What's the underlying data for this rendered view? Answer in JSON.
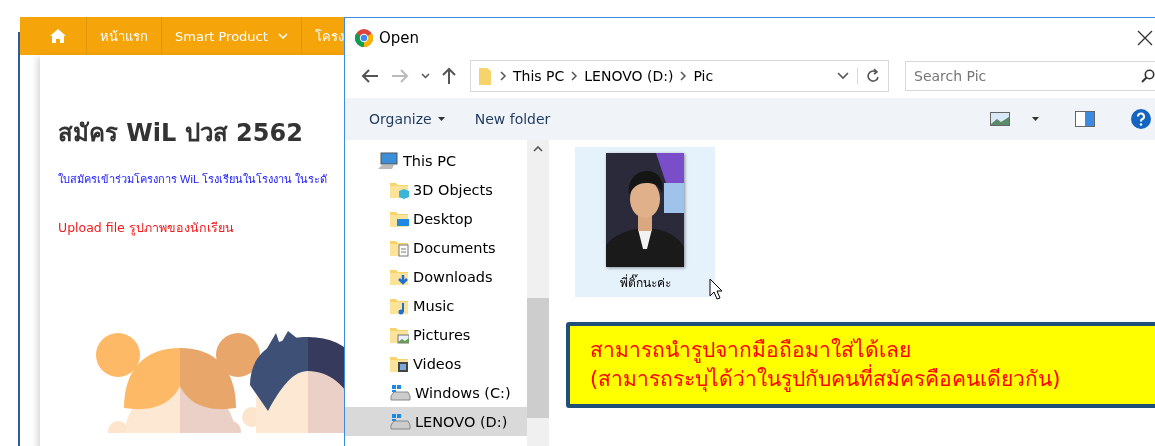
{
  "web_page": {
    "nav": [
      {
        "kind": "home"
      },
      {
        "kind": "link",
        "label": "หน้าแรก"
      },
      {
        "kind": "dropdown",
        "label": "Smart Product"
      },
      {
        "kind": "link",
        "label": "โครง"
      }
    ],
    "title": "สมัคร WiL ปวส 2562",
    "intro": "ใบสมัครเข้าร่วมโครงการ WiL โรงเรียนในโรงงาน ในระดั",
    "upload_note": "Upload file รูปภาพของนักเรียน"
  },
  "dialog": {
    "title": "Open",
    "breadcrumb": [
      "This PC",
      "LENOVO (D:)",
      "Pic"
    ],
    "search": {
      "placeholder": "Search Pic"
    },
    "toolbar": {
      "organize": "Organize",
      "new_folder": "New folder"
    },
    "nav_tree": [
      {
        "label": "This PC",
        "kind": "pc",
        "selected": false,
        "children": [
          {
            "label": "3D Objects",
            "kind": "objects",
            "selected": false
          },
          {
            "label": "Desktop",
            "kind": "desktop",
            "selected": false
          },
          {
            "label": "Documents",
            "kind": "documents",
            "selected": false
          },
          {
            "label": "Downloads",
            "kind": "downloads",
            "selected": false
          },
          {
            "label": "Music",
            "kind": "music",
            "selected": false
          },
          {
            "label": "Pictures",
            "kind": "pictures",
            "selected": false
          },
          {
            "label": "Videos",
            "kind": "videos",
            "selected": false
          },
          {
            "label": "Windows (C:)",
            "kind": "drive",
            "selected": false
          },
          {
            "label": "LENOVO (D:)",
            "kind": "drive",
            "selected": true
          }
        ]
      }
    ],
    "files": [
      {
        "name": "พี่ติ๊กนะค่ะ",
        "kind": "picture",
        "selected": true
      }
    ]
  },
  "callout": {
    "lines": [
      "สามารถนำรูปจากมือถือมาใส่ได้เลย",
      "(สามารถระบุได้ว่าในรูปกับคนที่สมัครคือคนเดียวกัน)"
    ]
  }
}
